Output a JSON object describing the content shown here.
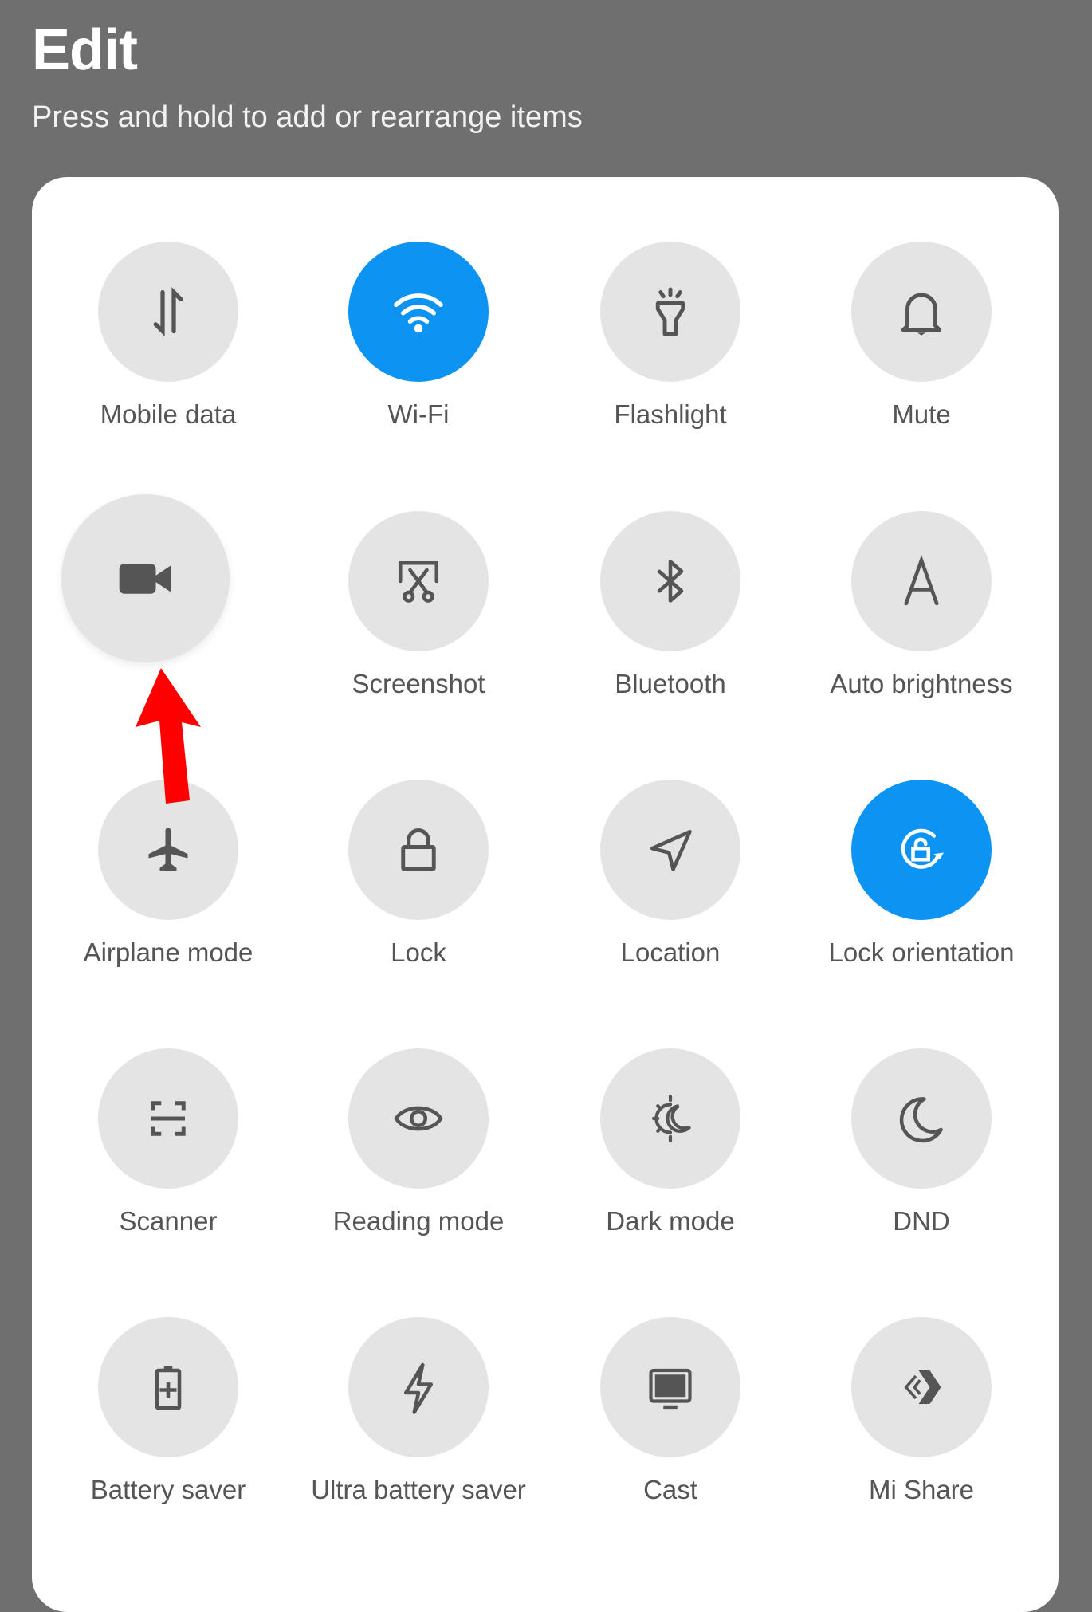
{
  "header": {
    "title": "Edit",
    "subtitle": "Press and hold to add or rearrange items"
  },
  "colors": {
    "background": "#6f6f6f",
    "tile_off": "#e4e4e4",
    "tile_on": "#0d93f2",
    "icon": "#555555",
    "annotation_arrow": "#ff0000"
  },
  "dragging_tile": {
    "icon": "video-camera-icon",
    "state": "being-dragged"
  },
  "tiles": [
    {
      "label": "Mobile data",
      "icon": "mobile-data-icon",
      "active": false
    },
    {
      "label": "Wi-Fi",
      "icon": "wifi-icon",
      "active": true
    },
    {
      "label": "Flashlight",
      "icon": "flashlight-icon",
      "active": false
    },
    {
      "label": "Mute",
      "icon": "bell-icon",
      "active": false
    },
    {
      "label": "Screenshot",
      "icon": "screenshot-icon",
      "active": false
    },
    {
      "label": "Bluetooth",
      "icon": "bluetooth-icon",
      "active": false
    },
    {
      "label": "Auto brightness",
      "icon": "auto-brightness-icon",
      "active": false
    },
    {
      "label": "Airplane mode",
      "icon": "airplane-icon",
      "active": false
    },
    {
      "label": "Lock",
      "icon": "lock-icon",
      "active": false
    },
    {
      "label": "Location",
      "icon": "location-icon",
      "active": false
    },
    {
      "label": "Lock orientation",
      "icon": "lock-orientation-icon",
      "active": true
    },
    {
      "label": "Scanner",
      "icon": "scanner-icon",
      "active": false
    },
    {
      "label": "Reading mode",
      "icon": "eye-icon",
      "active": false
    },
    {
      "label": "Dark mode",
      "icon": "dark-mode-icon",
      "active": false
    },
    {
      "label": "DND",
      "icon": "moon-icon",
      "active": false
    },
    {
      "label": "Battery saver",
      "icon": "battery-saver-icon",
      "active": false
    },
    {
      "label": "Ultra battery saver",
      "icon": "lightning-icon",
      "active": false
    },
    {
      "label": "Cast",
      "icon": "cast-icon",
      "active": false
    },
    {
      "label": "Mi Share",
      "icon": "mi-share-icon",
      "active": false
    }
  ]
}
